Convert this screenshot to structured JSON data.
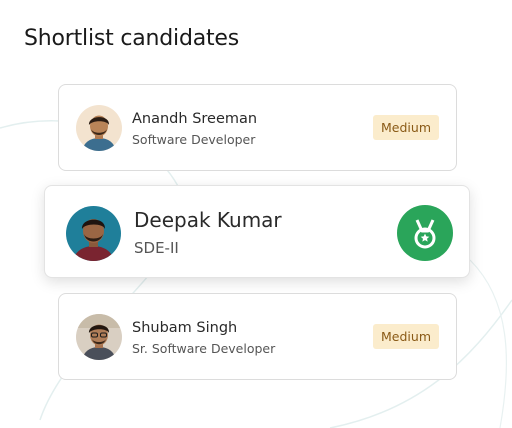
{
  "page": {
    "title": "Shortlist candidates"
  },
  "candidates": [
    {
      "name": "Anandh Sreeman",
      "role": "Software Developer",
      "badge": "Medium"
    },
    {
      "name": "Deepak Kumar",
      "role": "SDE-II",
      "badge_icon": "medal-icon"
    },
    {
      "name": "Shubam Singh",
      "role": "Sr. Software Developer",
      "badge": "Medium"
    }
  ],
  "colors": {
    "badge_bg": "#fbeccc",
    "badge_text": "#8a5a16",
    "medal": "#2aa55a",
    "card_border": "#dcdcdc"
  }
}
